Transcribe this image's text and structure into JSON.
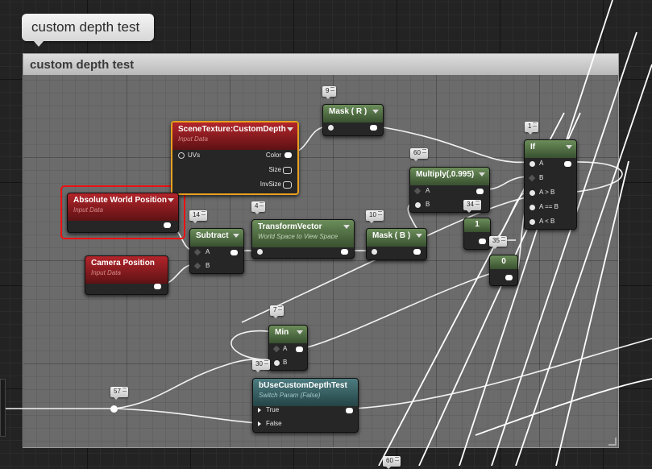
{
  "comment_bubble": {
    "text": "custom depth test"
  },
  "comment_box": {
    "title": "custom depth test"
  },
  "colors": {
    "input_header": "#8e1c20",
    "math_header": "#4f6f42",
    "switch_header": "#336064",
    "selection": "#e8a020",
    "annotation": "#ee1111"
  },
  "badges": [
    "9",
    "1",
    "60",
    "14",
    "4",
    "10",
    "34",
    "35",
    "7",
    "30",
    "57",
    "60"
  ],
  "nodes": {
    "scene_texture": {
      "title": "SceneTexture:CustomDepth",
      "subtitle": "Input Data",
      "in_pin": "UVs",
      "out_pins": [
        "Color",
        "Size",
        "InvSize"
      ]
    },
    "abs_world_pos": {
      "title": "Absolute World Position",
      "subtitle": "Input Data"
    },
    "camera_pos": {
      "title": "Camera Position",
      "subtitle": "Input Data"
    },
    "subtract": {
      "title": "Subtract",
      "pins": [
        "A",
        "B"
      ]
    },
    "transform_vector": {
      "title": "TransformVector",
      "subtitle": "World Space to View Space"
    },
    "mask_r": {
      "title": "Mask ( R )"
    },
    "mask_b": {
      "title": "Mask ( B )"
    },
    "multiply": {
      "title": "Multiply(,0.995)",
      "pins": [
        "A",
        "B"
      ]
    },
    "if_node": {
      "title": "If",
      "pins": [
        "A",
        "B",
        "A > B",
        "A == B",
        "A < B"
      ]
    },
    "const_1": {
      "value": "1"
    },
    "const_0": {
      "value": "0"
    },
    "min": {
      "title": "Min",
      "pins": [
        "A",
        "B"
      ]
    },
    "switch_param": {
      "title": "bUseCustomDepthTest",
      "subtitle": "Switch Param (False)",
      "pins": [
        "True",
        "False"
      ]
    }
  }
}
